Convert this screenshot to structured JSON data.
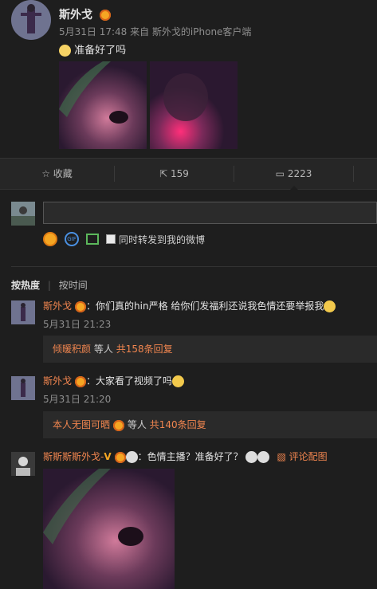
{
  "post": {
    "author": "斯外戈",
    "meta": "5月31日 17:48 来自 斯外戈的iPhone客户端",
    "text": "准备好了吗"
  },
  "actions": {
    "favorite": "收藏",
    "repost": "159",
    "comment": "2223"
  },
  "composer": {
    "repost_checkbox_label": "同时转发到我的微博"
  },
  "sort": {
    "hot": "按热度",
    "time": "按时间"
  },
  "comments": [
    {
      "author": "斯外戈",
      "text": "你们真的hin严格 给你们发福利还说我色情还要举报我",
      "time": "5月31日 21:23",
      "reply_user": "倾暖积颜",
      "reply_mid": "等人",
      "reply_count": "共158条回复"
    },
    {
      "author": "斯外戈",
      "text": "大家看了视频了吗",
      "time": "5月31日 21:20",
      "reply_user": "本人无图可晒",
      "reply_mid": "等人",
      "reply_count": "共140条回复"
    },
    {
      "author": "斯斯斯斯外戈-",
      "text": "色情主播？准备好了？",
      "link": "评论配图"
    }
  ]
}
